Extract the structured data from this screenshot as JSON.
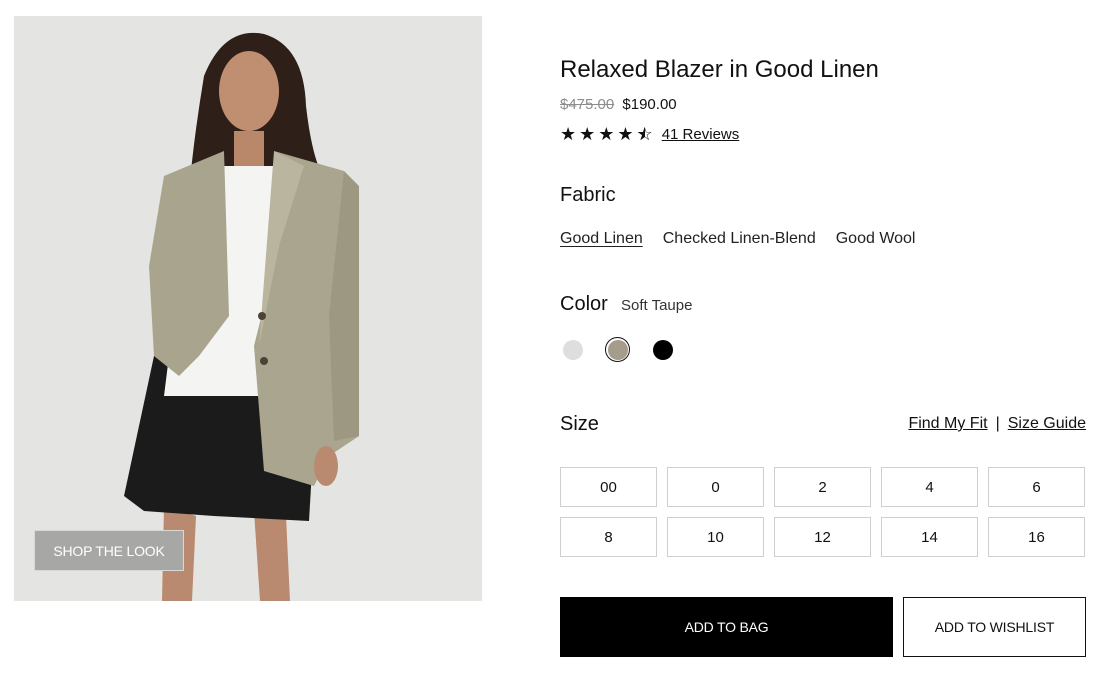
{
  "product": {
    "title": "Relaxed Blazer in Good Linen",
    "price_original": "$475.00",
    "price_sale": "$190.00",
    "rating": 4.5,
    "reviews_label": "41 Reviews"
  },
  "image": {
    "shop_the_look_label": "SHOP THE LOOK",
    "icon": "model-photo"
  },
  "fabric": {
    "label": "Fabric",
    "options": [
      "Good Linen",
      "Checked Linen-Blend",
      "Good Wool"
    ],
    "selected": "Good Linen"
  },
  "color": {
    "label": "Color",
    "selected_name": "Soft Taupe",
    "swatches": [
      {
        "color": "#dedede",
        "selected": false
      },
      {
        "color": "#a59c8c",
        "selected": true
      },
      {
        "color": "#000000",
        "selected": false
      }
    ]
  },
  "size": {
    "label": "Size",
    "find_my_fit": "Find My Fit",
    "separator": "|",
    "size_guide": "Size Guide",
    "options": [
      "00",
      "0",
      "2",
      "4",
      "6",
      "8",
      "10",
      "12",
      "14",
      "16"
    ]
  },
  "actions": {
    "add_to_bag": "ADD TO BAG",
    "add_to_wishlist": "ADD TO WISHLIST"
  }
}
